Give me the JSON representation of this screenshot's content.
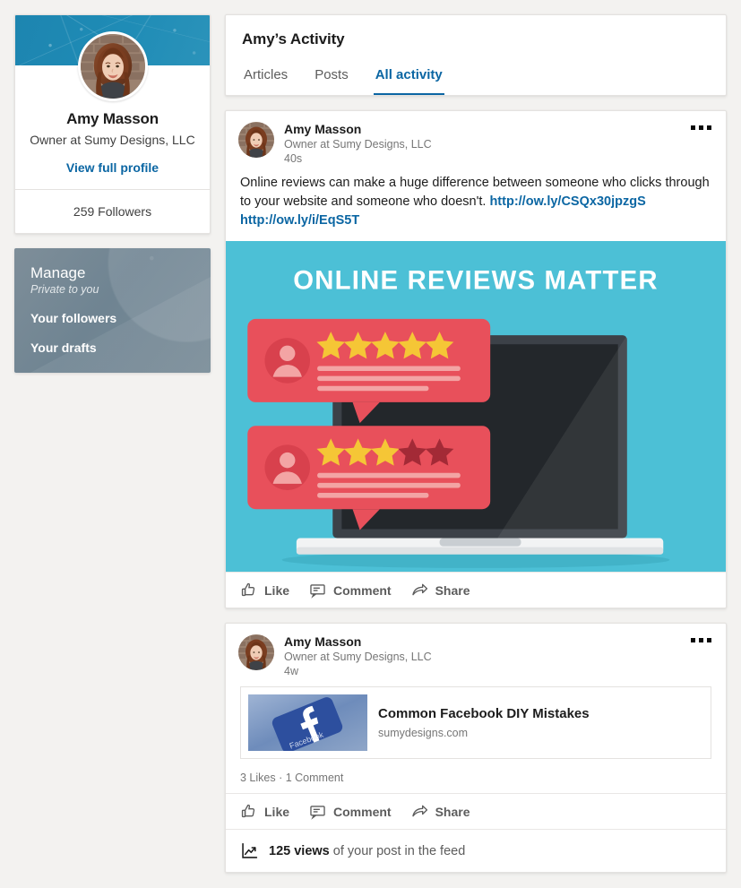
{
  "colors": {
    "accent_blue": "#0b66a3",
    "page_bg": "#f3f2f0",
    "cover_teal": "#1f8cb6",
    "manage_slate": "#74889a",
    "banner_teal": "#4cc0d6",
    "bubble_red": "#e8505b",
    "star_gold": "#f5c636"
  },
  "profile": {
    "name": "Amy Masson",
    "headline": "Owner at Sumy Designs, LLC",
    "view_profile_label": "View full profile",
    "followers": "259 Followers",
    "avatar_icon": "user-photo-avatar",
    "cover_icon": "network-pattern-cover"
  },
  "manage": {
    "title": "Manage",
    "subtitle": "Private to you",
    "items": [
      {
        "label": "Your followers",
        "name": "your-followers"
      },
      {
        "label": "Your drafts",
        "name": "your-drafts"
      }
    ]
  },
  "activity": {
    "title": "Amy’s Activity",
    "tabs": [
      {
        "label": "Articles",
        "active": false
      },
      {
        "label": "Posts",
        "active": false
      },
      {
        "label": "All activity",
        "active": true
      }
    ]
  },
  "actions": {
    "like": "Like",
    "comment": "Comment",
    "share": "Share",
    "like_icon": "thumbs-up-icon",
    "comment_icon": "speech-bubble-icon",
    "share_icon": "share-arrow-icon",
    "more_icon": "overflow-menu-icon"
  },
  "posts": [
    {
      "author": "Amy Masson",
      "headline": "Owner at Sumy Designs, LLC",
      "time": "40s",
      "text_before": "Online reviews can make a huge difference between someone who clicks through to your website and someone who doesn't. ",
      "link1": "http://ow.ly/CSQx30jpzgS",
      "link2": "http://ow.ly/i/EqS5T",
      "media": {
        "type": "illustration-banner",
        "headline": "ONLINE REVIEWS MATTER",
        "review_top_stars_filled": 5,
        "review_top_stars_total": 5,
        "review_bottom_stars_filled": 3,
        "review_bottom_stars_total": 5,
        "alt": "Laptop with two review speech bubbles on a teal background"
      }
    },
    {
      "author": "Amy Masson",
      "headline": "Owner at Sumy Designs, LLC",
      "time": "4w",
      "link_preview": {
        "title": "Common Facebook DIY Mistakes",
        "domain": "sumydesigns.com",
        "thumb_icon": "facebook-logo-thumbnail"
      },
      "social_counts": "3 Likes · 1 Comment",
      "views": {
        "count": "125 views",
        "suffix": " of your post in the feed",
        "icon": "analytics-chart-icon"
      }
    }
  ]
}
